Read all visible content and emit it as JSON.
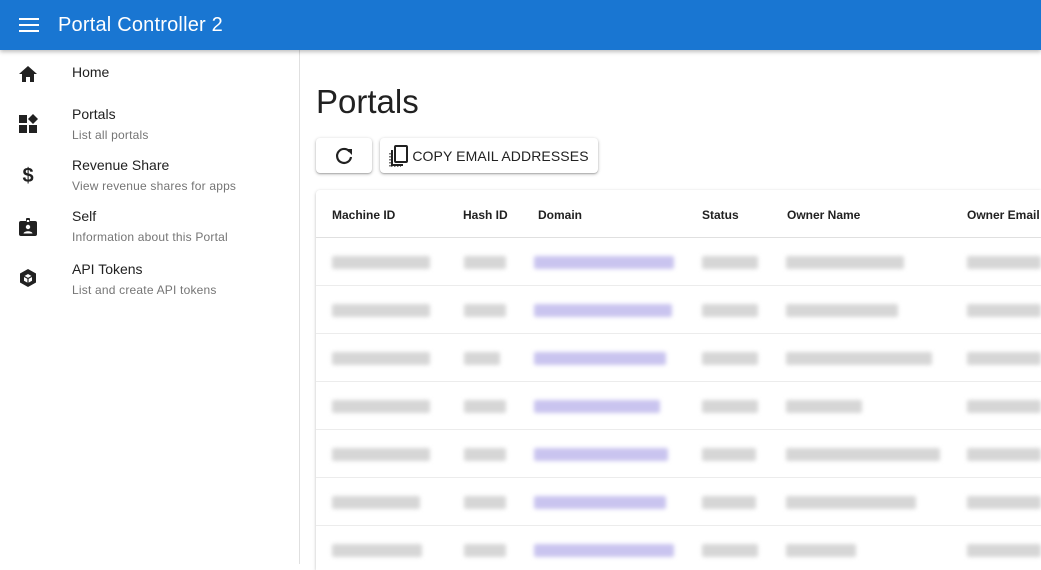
{
  "app": {
    "title": "Portal Controller 2"
  },
  "nav": {
    "items": [
      {
        "label": "Home",
        "description": "",
        "icon": "home-icon"
      },
      {
        "label": "Portals",
        "description": "List all portals",
        "icon": "dashboard-icon"
      },
      {
        "label": "Revenue Share",
        "description": "View revenue shares for apps",
        "icon": "dollar-icon"
      },
      {
        "label": "Self",
        "description": "Information about this Portal",
        "icon": "badge-icon"
      },
      {
        "label": "API Tokens",
        "description": "List and create API tokens",
        "icon": "cube-icon"
      }
    ]
  },
  "page": {
    "title": "Portals"
  },
  "toolbar": {
    "copy_label": "COPY EMAIL ADDRESSES"
  },
  "table": {
    "columns": [
      "Machine ID",
      "Hash ID",
      "Domain",
      "Status",
      "Owner Name",
      "Owner Email"
    ],
    "row_count": 7,
    "rows_redacted": true
  },
  "colors": {
    "appbar": "#1976d2",
    "link_redacted": "#c9c4ef"
  }
}
